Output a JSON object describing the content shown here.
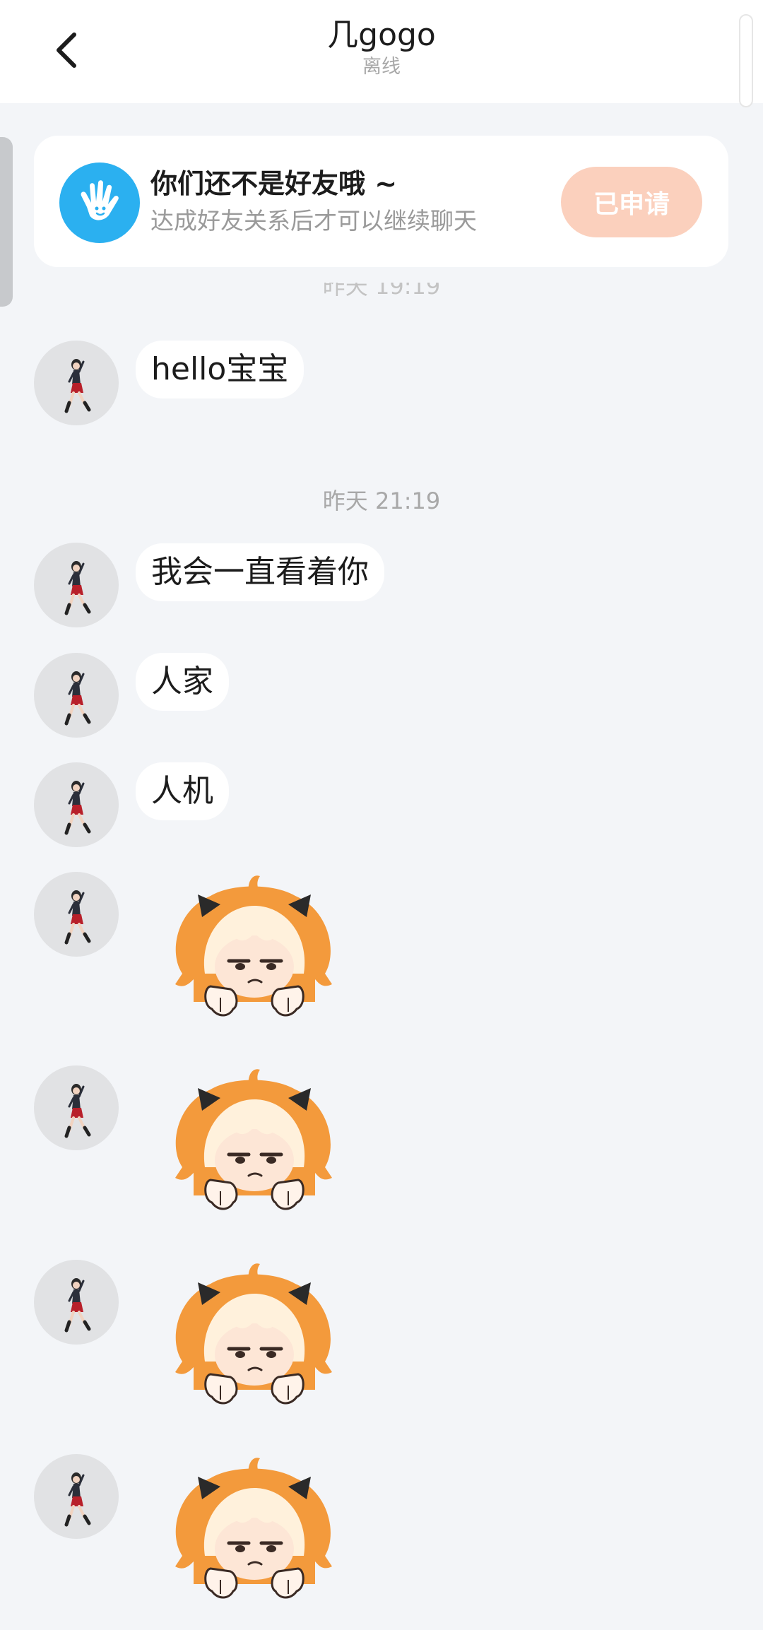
{
  "header": {
    "title": "几gogo",
    "status": "离线",
    "back_icon": "chevron-left-icon"
  },
  "notice": {
    "icon": "waving-hand-icon",
    "title": "你们还不是好友哦 ~",
    "description": "达成好友关系后才可以继续聊天",
    "button_label": "已申请",
    "button_color": "#fbd0bd",
    "icon_color": "#2bb0f0"
  },
  "partial_time_label": "昨天 19:19",
  "messages": [
    {
      "type": "text",
      "text": "hello宝宝"
    },
    {
      "type": "time",
      "text": "昨天 21:19"
    },
    {
      "type": "text",
      "text": "我会一直看着你"
    },
    {
      "type": "text",
      "text": "人家"
    },
    {
      "type": "text",
      "text": "人机"
    },
    {
      "type": "sticker",
      "sticker": "unamused-orange-hair-girl-sticker"
    },
    {
      "type": "sticker",
      "sticker": "unamused-orange-hair-girl-sticker"
    },
    {
      "type": "sticker",
      "sticker": "unamused-orange-hair-girl-sticker"
    },
    {
      "type": "sticker",
      "sticker": "unamused-orange-hair-girl-sticker"
    }
  ],
  "colors": {
    "background": "#f3f5f8",
    "bubble": "#ffffff",
    "sticker_hair": "#f39a3c"
  }
}
